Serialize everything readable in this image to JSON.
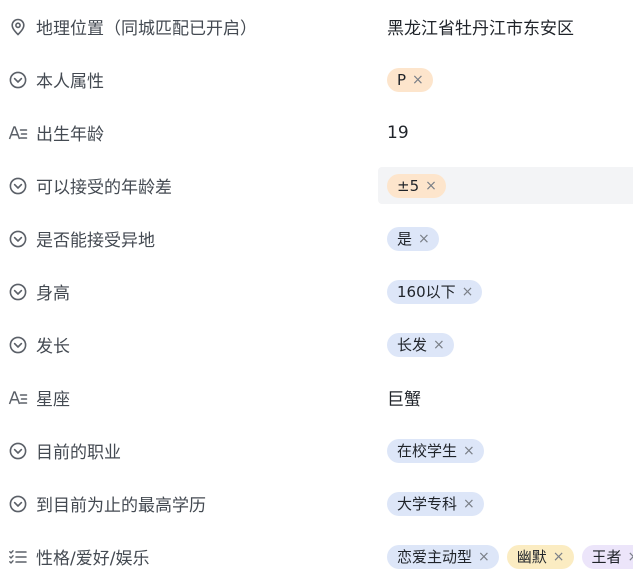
{
  "fields": {
    "location": {
      "label": "地理位置（同城匹配已开启）",
      "icon": "location-pin-icon",
      "value": "黑龙江省牡丹江市东安区"
    },
    "attribute": {
      "label": "本人属性",
      "icon": "chevron-down-circle-icon",
      "tag": "P",
      "tag_color": "#fde5cc"
    },
    "birth_year": {
      "label": "出生年龄",
      "icon": "text-field-icon",
      "value": "19"
    },
    "age_diff": {
      "label": "可以接受的年龄差",
      "icon": "chevron-down-circle-icon",
      "tag": "±5",
      "tag_color": "#fde5cc"
    },
    "long_distance": {
      "label": "是否能接受异地",
      "icon": "chevron-down-circle-icon",
      "tag": "是",
      "tag_color": "#dde6f8"
    },
    "height": {
      "label": "身高",
      "icon": "chevron-down-circle-icon",
      "tag": "160以下",
      "tag_color": "#dde6f8"
    },
    "hair": {
      "label": "发长",
      "icon": "chevron-down-circle-icon",
      "tag": "长发",
      "tag_color": "#dde6f8"
    },
    "zodiac": {
      "label": "星座",
      "icon": "text-field-icon",
      "value": "巨蟹"
    },
    "occupation": {
      "label": "目前的职业",
      "icon": "chevron-down-circle-icon",
      "tag": "在校学生",
      "tag_color": "#dde6f8"
    },
    "education": {
      "label": "到目前为止的最高学历",
      "icon": "chevron-down-circle-icon",
      "tag": "大学专科",
      "tag_color": "#dde6f8"
    },
    "personality": {
      "label": "性格/爱好/娱乐",
      "icon": "multi-select-list-icon",
      "tags": [
        {
          "text": "恋爱主动型",
          "color": "#dde6f8"
        },
        {
          "text": "幽默",
          "color": "#fbecc2"
        },
        {
          "text": "王者",
          "color": "#ece5fa"
        }
      ]
    }
  },
  "remove_glyph": "×"
}
